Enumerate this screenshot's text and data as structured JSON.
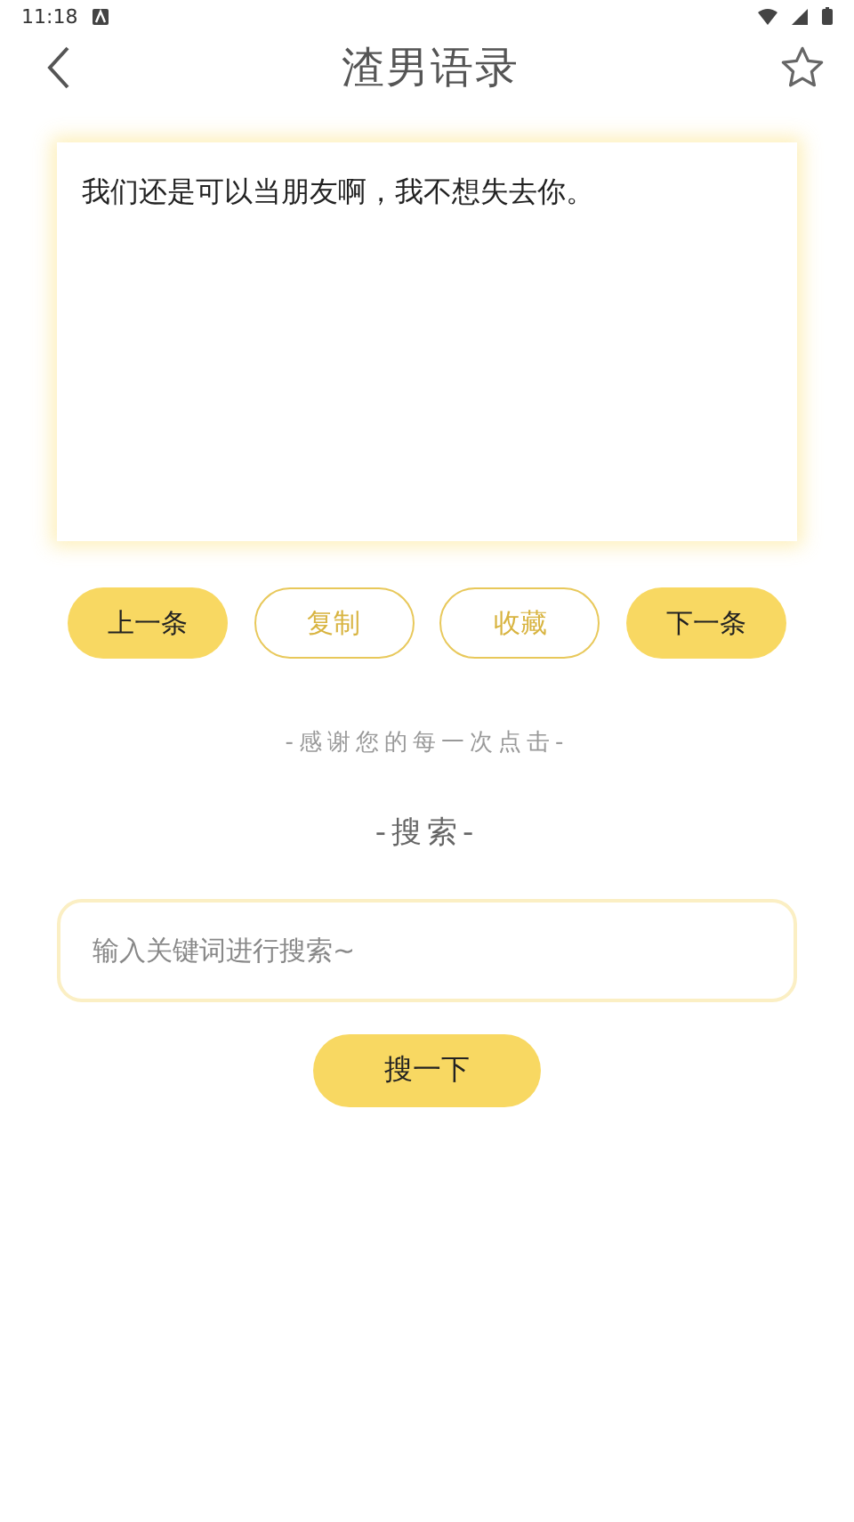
{
  "status_bar": {
    "time": "11:18"
  },
  "header": {
    "title": "渣男语录",
    "favorite": false
  },
  "quote": {
    "text": "我们还是可以当朋友啊，我不想失去你。"
  },
  "actions": [
    {
      "label": "上一条",
      "kind": "filled"
    },
    {
      "label": "复制",
      "kind": "outline"
    },
    {
      "label": "收藏",
      "kind": "outline"
    },
    {
      "label": "下一条",
      "kind": "filled"
    }
  ],
  "thanks": "-感谢您的每一次点击-",
  "search": {
    "heading": "-搜索-",
    "placeholder": "输入关键词进行搜索~",
    "button": "搜一下"
  }
}
